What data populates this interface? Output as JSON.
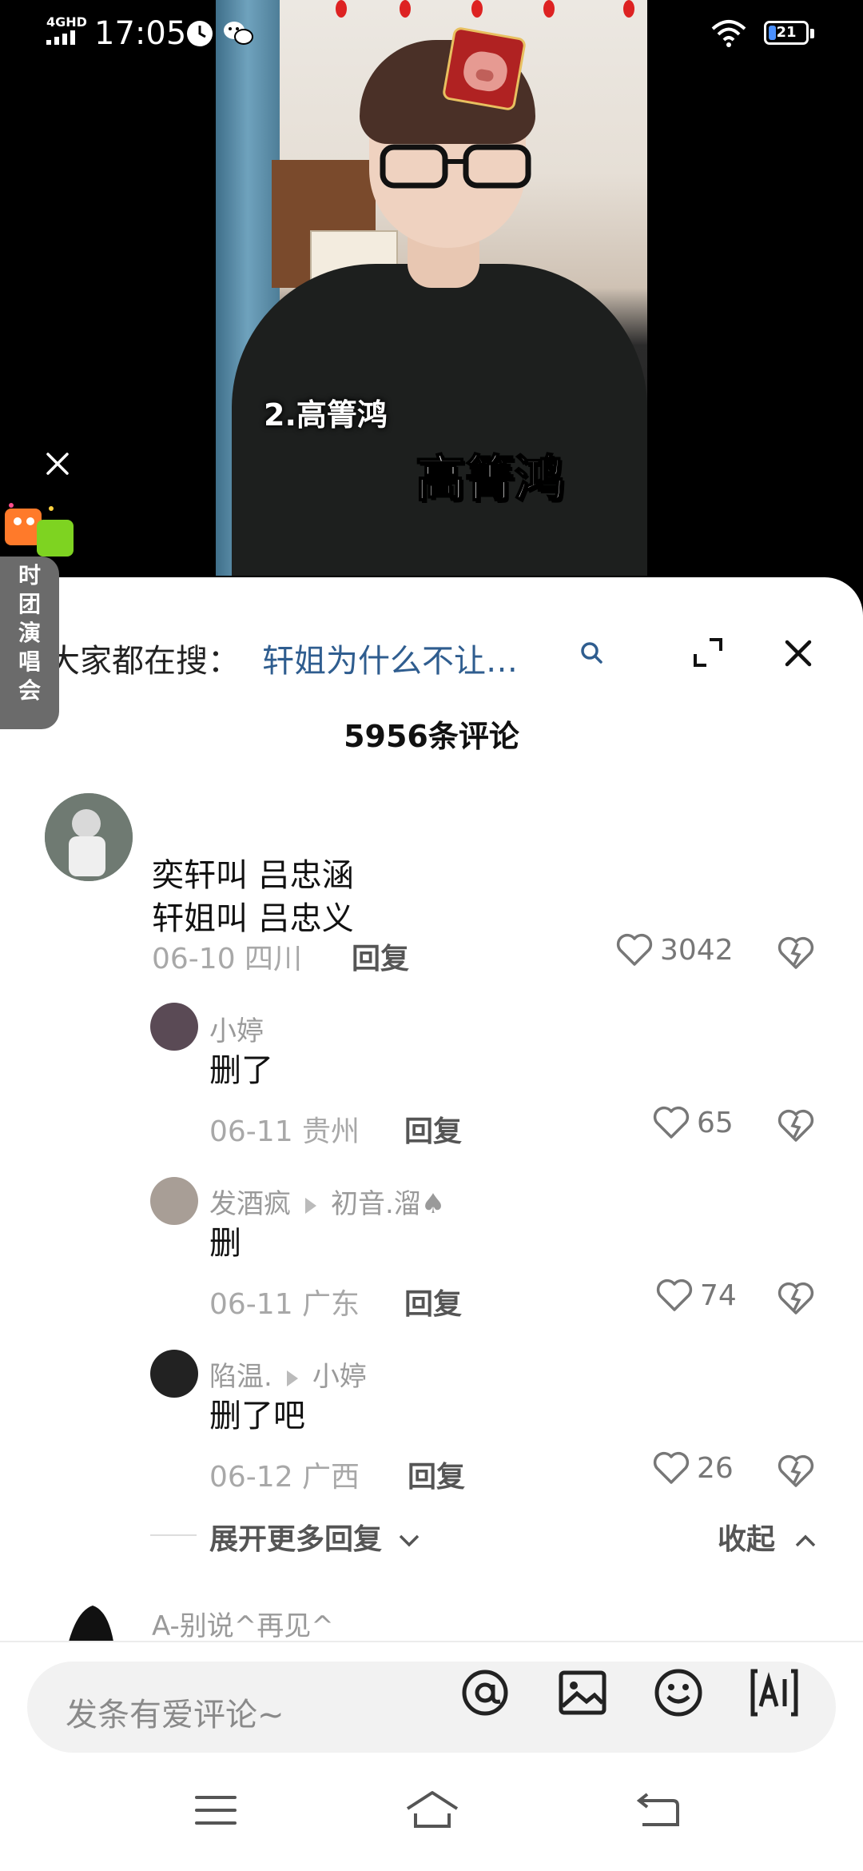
{
  "status_bar": {
    "network": "4GHD",
    "time": "17:05",
    "battery": "21",
    "battery_level": 0.21,
    "icons": [
      "signal-icon",
      "clock-app-icon",
      "wechat-icon",
      "wifi-icon",
      "battery-icon"
    ]
  },
  "video": {
    "caption_small": "2.高箐鸿",
    "caption_big": "高箐鸿"
  },
  "promo": {
    "text": "时\n团\n演\n唱\n会"
  },
  "search": {
    "prefix": "大家都在搜：",
    "query": "轩姐为什么不让…"
  },
  "comments_header": {
    "count_label": "5956条评论"
  },
  "comments": [
    {
      "text": "奕轩叫 吕忠涵\n轩姐叫 吕忠义",
      "meta": "06-10 四川",
      "reply_label": "回复",
      "likes": "3042",
      "avatar_color": "#7b8a80"
    }
  ],
  "replies": [
    {
      "name": "小婷",
      "reply_to": "",
      "text": "删了",
      "meta": "06-11 贵州",
      "reply_label": "回复",
      "likes": "65",
      "avatar_color": "#5a4a55"
    },
    {
      "name": "发酒疯",
      "reply_to": "初音.溜♠",
      "text": "删",
      "meta": "06-11 广东",
      "reply_label": "回复",
      "likes": "74",
      "avatar_color": "#a89e96"
    },
    {
      "name": "陷温.",
      "reply_to": "小婷",
      "text": "删了吧",
      "meta": "06-12 广西",
      "reply_label": "回复",
      "likes": "26",
      "avatar_color": "#222222"
    }
  ],
  "thread_controls": {
    "expand_label": "展开更多回复",
    "collapse_label": "收起"
  },
  "next_comment": {
    "name": "A-别说^再见^"
  },
  "input_bar": {
    "placeholder": "发条有爱评论~",
    "icons": [
      "at-icon",
      "image-icon",
      "emoji-icon",
      "ai-icon"
    ]
  },
  "nav_bar": {
    "icons": [
      "menu-icon",
      "home-icon",
      "back-icon"
    ]
  },
  "colors": {
    "search_query": "#2f5d8f",
    "secondary_text": "#9a9a9a",
    "sheet_bg": "#ffffff",
    "input_bg": "#f2f2f2"
  }
}
